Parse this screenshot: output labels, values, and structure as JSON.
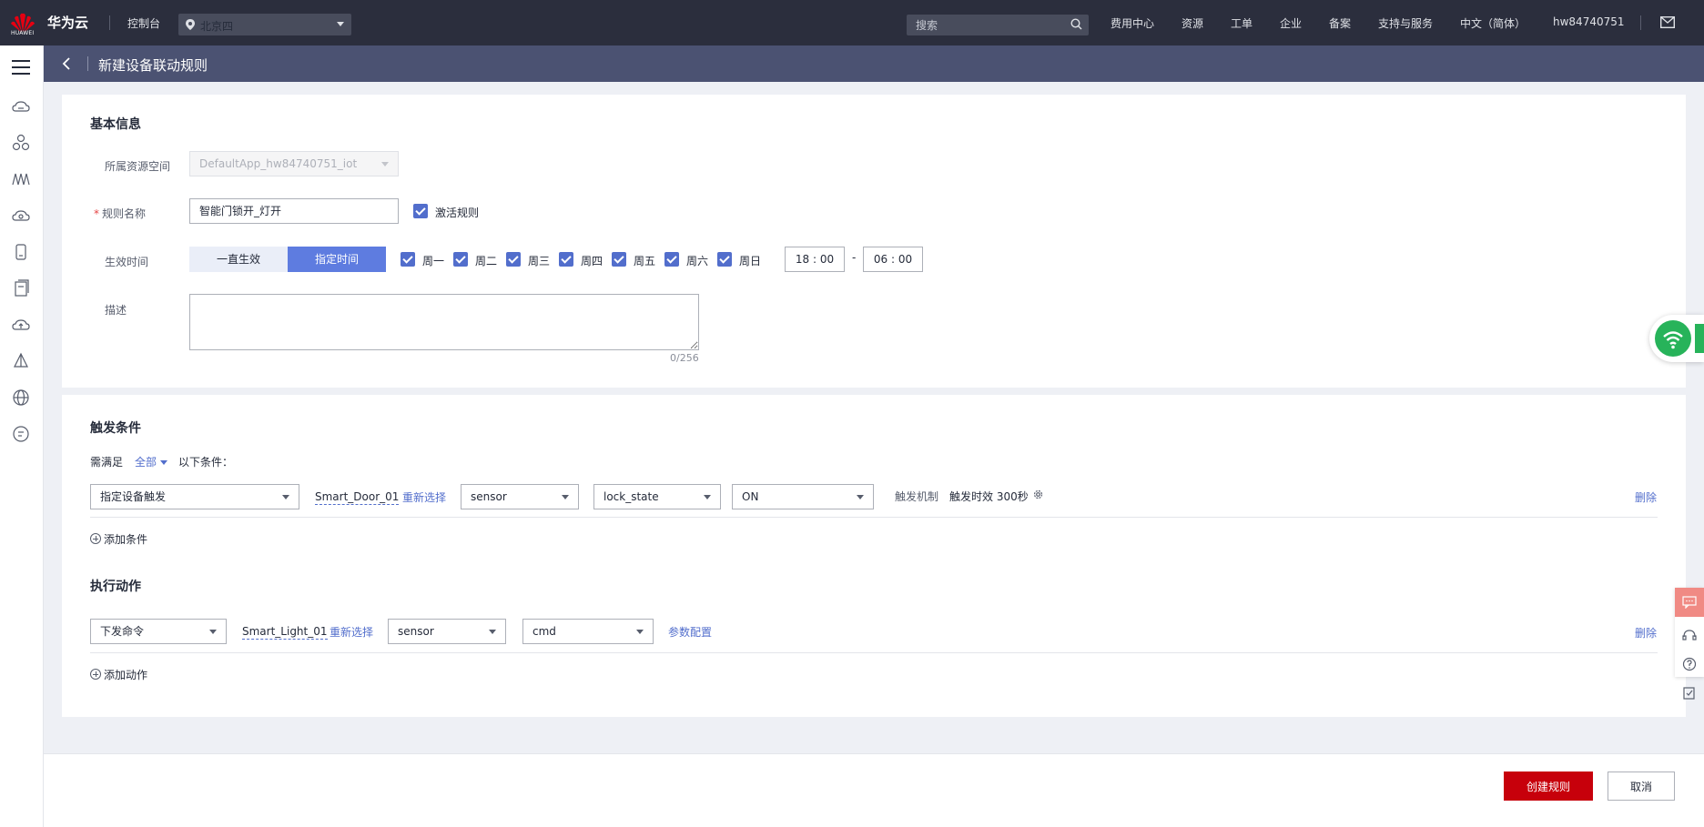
{
  "topbar": {
    "brand": "华为云",
    "logo_text": "HUAWEI",
    "console": "控制台",
    "region": "北京四",
    "search_placeholder": "搜索",
    "nav": [
      "费用中心",
      "资源",
      "工单",
      "企业",
      "备案",
      "支持与服务",
      "中文（简体）",
      "hw84740751"
    ]
  },
  "sidebar": {
    "icons": [
      "cloud-icon",
      "cluster-icon",
      "waveform-icon",
      "cloud-disk-icon",
      "device-icon",
      "document-icon",
      "cloud-upload-icon",
      "cone-icon",
      "globe-icon",
      "chat-bubble-icon"
    ]
  },
  "page": {
    "title": "新建设备联动规则"
  },
  "basic": {
    "section_title": "基本信息",
    "space_label": "所属资源空间",
    "space_value": "DefaultApp_hw84740751_iot",
    "name_label": "规则名称",
    "name_value": "智能门锁开_灯开",
    "activate_label": "激活规则",
    "time_label": "生效时间",
    "always_label": "一直生效",
    "specified_label": "指定时间",
    "days": [
      "周一",
      "周二",
      "周三",
      "周四",
      "周五",
      "周六",
      "周日"
    ],
    "time_start": "18 : 00",
    "time_dash": "-",
    "time_end": "06 : 00",
    "desc_label": "描述",
    "desc_counter": "0/256"
  },
  "trigger": {
    "section_title": "触发条件",
    "need_label": "需满足",
    "scope_label": "全部",
    "following_label": "以下条件：",
    "type_value": "指定设备触发",
    "device_name": "Smart_Door_01",
    "reselect": "重新选择",
    "service_value": "sensor",
    "property_value": "lock_state",
    "state_value": "ON",
    "mechanism_label": "触发机制",
    "mechanism_value": "触发时效 300秒",
    "delete": "删除",
    "add_label": "添加条件"
  },
  "action": {
    "section_title": "执行动作",
    "type_value": "下发命令",
    "device_name": "Smart_Light_01",
    "reselect": "重新选择",
    "service_value": "sensor",
    "command_value": "cmd",
    "param_config": "参数配置",
    "delete": "删除",
    "add_label": "添加动作"
  },
  "footer": {
    "create_label": "创建规则",
    "cancel_label": "取消"
  },
  "colors": {
    "topbar": "#2b2e3d",
    "pagehead": "#4b5272",
    "primary_red": "#c7000b",
    "accent_blue": "#5e7ce0",
    "link_blue": "#526ecc"
  }
}
